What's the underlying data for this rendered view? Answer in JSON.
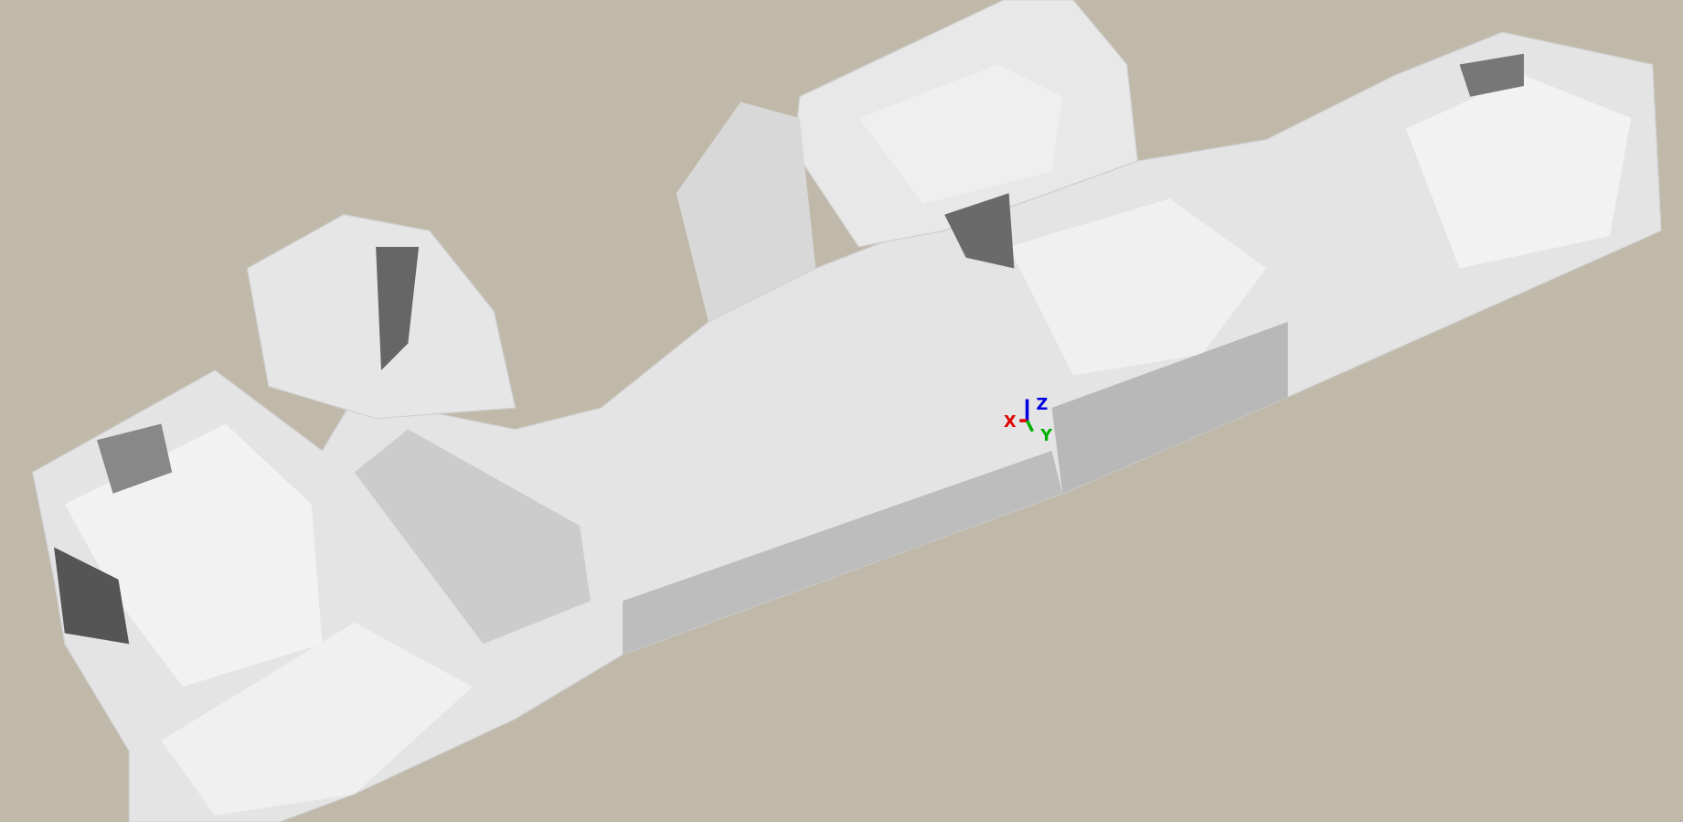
{
  "viewport": {
    "axes": [
      {
        "label": "Z",
        "color": "#0000e0"
      },
      {
        "label": "X",
        "color": "#e00000"
      },
      {
        "label": "Y",
        "color": "#00b000"
      }
    ]
  }
}
